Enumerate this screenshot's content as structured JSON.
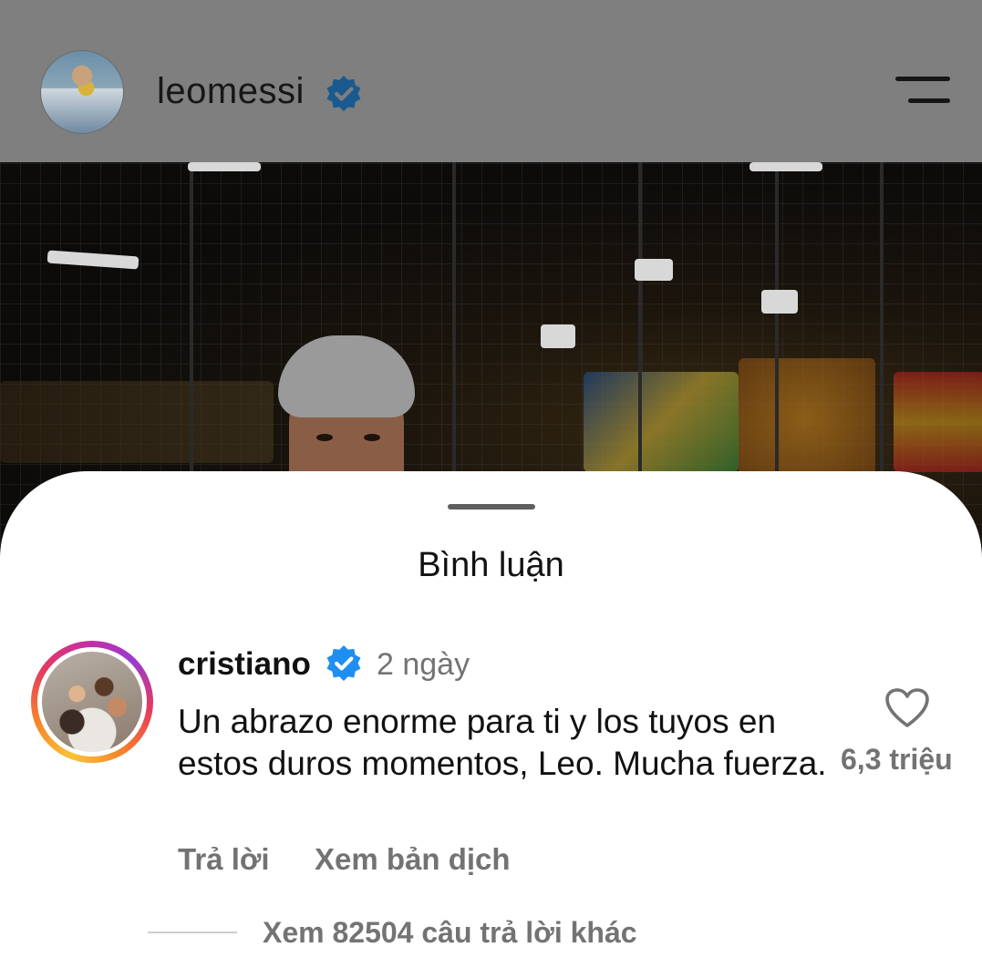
{
  "header": {
    "username": "leomessi",
    "verified": true
  },
  "sheet": {
    "title": "Bình luận"
  },
  "comment": {
    "username": "cristiano",
    "verified": true,
    "time": "2 ngày",
    "text": "Un abrazo enorme para ti y los tuyos en estos duros momentos, Leo. Mucha fuerza.",
    "like_count": "6,3 triệu",
    "reply_label": "Trả lời",
    "translate_label": "Xem bản dịch",
    "more_replies_label": "Xem 82504 câu trả lời khác"
  },
  "colors": {
    "verified_blue": "#1f8ef1",
    "muted_text": "#737373",
    "header_dim": "#7f7f7f"
  },
  "icons": {
    "verified": "verified-badge-icon",
    "menu": "hamburger-menu-icon",
    "like": "heart-icon"
  }
}
